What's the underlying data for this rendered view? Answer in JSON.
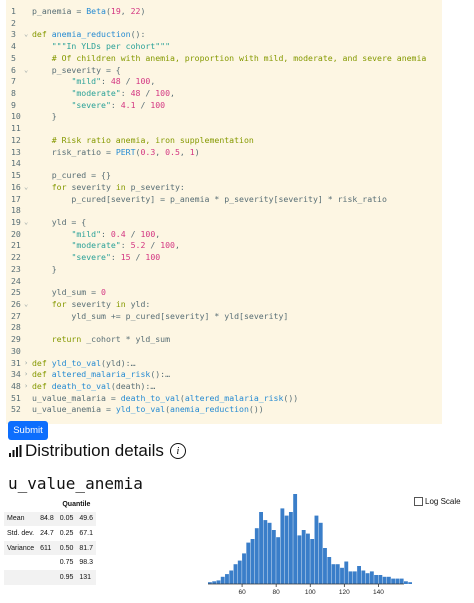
{
  "editor": {
    "lines": [
      {
        "n": "1",
        "fold": "",
        "segs": [
          [
            "p_anemia = ",
            ""
          ],
          [
            "Beta",
            "fn"
          ],
          [
            "(",
            ""
          ],
          [
            "19",
            "num"
          ],
          [
            ", ",
            ""
          ],
          [
            "22",
            "num"
          ],
          [
            ")",
            ""
          ]
        ]
      },
      {
        "n": "2",
        "fold": "",
        "segs": []
      },
      {
        "n": "3",
        "fold": "⌄",
        "segs": [
          [
            "def",
            "kw"
          ],
          [
            " ",
            ""
          ],
          [
            "anemia_reduction",
            "def"
          ],
          [
            "():",
            ""
          ]
        ]
      },
      {
        "n": "4",
        "fold": "",
        "segs": [
          [
            "    ",
            ""
          ],
          [
            "\"\"\"In YLDs per cohort\"\"\"",
            "str"
          ]
        ]
      },
      {
        "n": "5",
        "fold": "",
        "segs": [
          [
            "    ",
            ""
          ],
          [
            "# Of children with anemia, proportion with mild, moderate, and severe anemia",
            "kw"
          ]
        ]
      },
      {
        "n": "6",
        "fold": "⌄",
        "segs": [
          [
            "    p_severity = {",
            ""
          ]
        ]
      },
      {
        "n": "7",
        "fold": "",
        "segs": [
          [
            "        ",
            ""
          ],
          [
            "\"mild\"",
            "str"
          ],
          [
            ": ",
            ""
          ],
          [
            "48",
            "num"
          ],
          [
            " / ",
            ""
          ],
          [
            "100",
            "num"
          ],
          [
            ",",
            ""
          ]
        ]
      },
      {
        "n": "8",
        "fold": "",
        "segs": [
          [
            "        ",
            ""
          ],
          [
            "\"moderate\"",
            "str"
          ],
          [
            ": ",
            ""
          ],
          [
            "48",
            "num"
          ],
          [
            " / ",
            ""
          ],
          [
            "100",
            "num"
          ],
          [
            ",",
            ""
          ]
        ]
      },
      {
        "n": "9",
        "fold": "",
        "segs": [
          [
            "        ",
            ""
          ],
          [
            "\"severe\"",
            "str"
          ],
          [
            ": ",
            ""
          ],
          [
            "4.1",
            "num"
          ],
          [
            " / ",
            ""
          ],
          [
            "100",
            "num"
          ]
        ]
      },
      {
        "n": "10",
        "fold": "",
        "segs": [
          [
            "    }",
            ""
          ]
        ]
      },
      {
        "n": "11",
        "fold": "",
        "segs": []
      },
      {
        "n": "12",
        "fold": "",
        "segs": [
          [
            "    ",
            ""
          ],
          [
            "# Risk ratio anemia, iron supplementation",
            "kw"
          ]
        ]
      },
      {
        "n": "13",
        "fold": "",
        "segs": [
          [
            "    risk_ratio = ",
            ""
          ],
          [
            "PERT",
            "fn"
          ],
          [
            "(",
            ""
          ],
          [
            "0.3",
            "num"
          ],
          [
            ", ",
            ""
          ],
          [
            "0.5",
            "num"
          ],
          [
            ", ",
            ""
          ],
          [
            "1",
            "num"
          ],
          [
            ")",
            ""
          ]
        ]
      },
      {
        "n": "14",
        "fold": "",
        "segs": []
      },
      {
        "n": "15",
        "fold": "",
        "segs": [
          [
            "    p_cured = {}",
            ""
          ]
        ]
      },
      {
        "n": "16",
        "fold": "⌄",
        "segs": [
          [
            "    ",
            ""
          ],
          [
            "for",
            "kw"
          ],
          [
            " severity ",
            ""
          ],
          [
            "in",
            "kw"
          ],
          [
            " p_severity:",
            ""
          ]
        ]
      },
      {
        "n": "17",
        "fold": "",
        "segs": [
          [
            "        p_cured[severity] = p_anemia * p_severity[severity] * risk_ratio",
            ""
          ]
        ]
      },
      {
        "n": "18",
        "fold": "",
        "segs": []
      },
      {
        "n": "19",
        "fold": "⌄",
        "segs": [
          [
            "    yld = {",
            ""
          ]
        ]
      },
      {
        "n": "20",
        "fold": "",
        "segs": [
          [
            "        ",
            ""
          ],
          [
            "\"mild\"",
            "str"
          ],
          [
            ": ",
            ""
          ],
          [
            "0.4",
            "num"
          ],
          [
            " / ",
            ""
          ],
          [
            "100",
            "num"
          ],
          [
            ",",
            ""
          ]
        ]
      },
      {
        "n": "21",
        "fold": "",
        "segs": [
          [
            "        ",
            ""
          ],
          [
            "\"moderate\"",
            "str"
          ],
          [
            ": ",
            ""
          ],
          [
            "5.2",
            "num"
          ],
          [
            " / ",
            ""
          ],
          [
            "100",
            "num"
          ],
          [
            ",",
            ""
          ]
        ]
      },
      {
        "n": "22",
        "fold": "",
        "segs": [
          [
            "        ",
            ""
          ],
          [
            "\"severe\"",
            "str"
          ],
          [
            ": ",
            ""
          ],
          [
            "15",
            "num"
          ],
          [
            " / ",
            ""
          ],
          [
            "100",
            "num"
          ]
        ]
      },
      {
        "n": "23",
        "fold": "",
        "segs": [
          [
            "    }",
            ""
          ]
        ]
      },
      {
        "n": "24",
        "fold": "",
        "segs": []
      },
      {
        "n": "25",
        "fold": "",
        "segs": [
          [
            "    yld_sum = ",
            ""
          ],
          [
            "0",
            "num"
          ]
        ]
      },
      {
        "n": "26",
        "fold": "⌄",
        "segs": [
          [
            "    ",
            ""
          ],
          [
            "for",
            "kw"
          ],
          [
            " severity ",
            ""
          ],
          [
            "in",
            "kw"
          ],
          [
            " yld:",
            ""
          ]
        ]
      },
      {
        "n": "27",
        "fold": "",
        "segs": [
          [
            "        yld_sum += p_cured[severity] * yld[severity]",
            ""
          ]
        ]
      },
      {
        "n": "28",
        "fold": "",
        "segs": []
      },
      {
        "n": "29",
        "fold": "",
        "segs": [
          [
            "    ",
            ""
          ],
          [
            "return",
            "kw"
          ],
          [
            " _cohort * yld_sum",
            ""
          ]
        ]
      },
      {
        "n": "30",
        "fold": "",
        "segs": []
      },
      {
        "n": "31",
        "fold": "›",
        "segs": [
          [
            "def",
            "kw"
          ],
          [
            " ",
            ""
          ],
          [
            "yld_to_val",
            "def"
          ],
          [
            "(yld):…",
            ""
          ]
        ]
      },
      {
        "n": "34",
        "fold": "›",
        "segs": [
          [
            "def",
            "kw"
          ],
          [
            " ",
            ""
          ],
          [
            "altered_malaria_risk",
            "def"
          ],
          [
            "():…",
            ""
          ]
        ]
      },
      {
        "n": "48",
        "fold": "›",
        "segs": [
          [
            "def",
            "kw"
          ],
          [
            " ",
            ""
          ],
          [
            "death_to_val",
            "def"
          ],
          [
            "(death):…",
            ""
          ]
        ]
      },
      {
        "n": "51",
        "fold": "",
        "segs": [
          [
            "u_value_malaria = ",
            ""
          ],
          [
            "death_to_val",
            "fn"
          ],
          [
            "(",
            ""
          ],
          [
            "altered_malaria_risk",
            "fn"
          ],
          [
            "())",
            ""
          ]
        ]
      },
      {
        "n": "52",
        "fold": "",
        "segs": [
          [
            "u_value_anemia = ",
            ""
          ],
          [
            "yld_to_val",
            "fn"
          ],
          [
            "(",
            ""
          ],
          [
            "anemia_reduction",
            "fn"
          ],
          [
            "())",
            ""
          ]
        ]
      }
    ]
  },
  "submit_label": "Submit",
  "details": {
    "title": "Distribution details",
    "info_glyph": "i",
    "variable": "u_value_anemia",
    "quantile_header": "Quantile",
    "summary": [
      {
        "label": "Mean",
        "value": "84.8"
      },
      {
        "label": "Std. dev.",
        "value": "24.7"
      },
      {
        "label": "Variance",
        "value": "611"
      }
    ],
    "quantiles": [
      {
        "q": "0.05",
        "v": "49.6"
      },
      {
        "q": "0.25",
        "v": "67.1"
      },
      {
        "q": "0.50",
        "v": "81.7"
      },
      {
        "q": "0.75",
        "v": "98.3"
      },
      {
        "q": "0.95",
        "v": "131"
      }
    ],
    "log_scale_label": "Log Scale",
    "log_scale_checked": false
  },
  "chart_data": {
    "type": "bar",
    "title": "",
    "xlabel": "",
    "ylabel": "",
    "xlim": [
      40,
      155
    ],
    "xticks": [
      "60",
      "80",
      "100",
      "120",
      "140"
    ],
    "bin_width": 2.5,
    "bin_start": 40,
    "values": [
      2,
      3,
      4,
      8,
      11,
      15,
      22,
      26,
      34,
      46,
      50,
      62,
      80,
      71,
      68,
      60,
      52,
      84,
      76,
      80,
      100,
      54,
      60,
      56,
      50,
      76,
      68,
      40,
      30,
      22,
      22,
      18,
      25,
      14,
      14,
      20,
      15,
      12,
      14,
      10,
      10,
      8,
      8,
      6,
      6,
      6,
      3,
      2
    ],
    "color": "#3a7ec9"
  }
}
